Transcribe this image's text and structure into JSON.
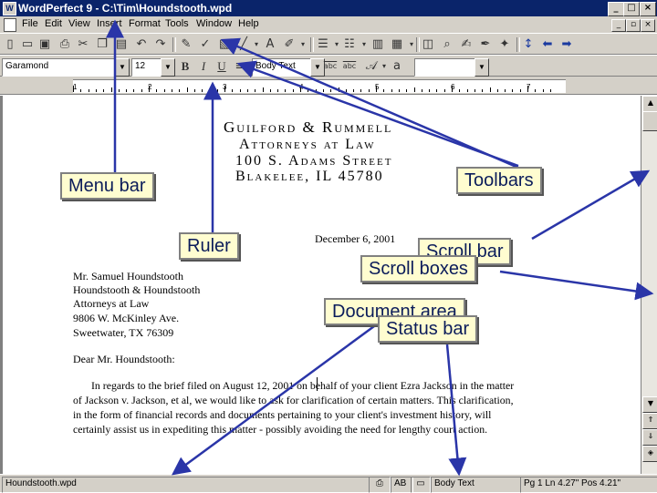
{
  "window": {
    "title": "WordPerfect 9 - C:\\Tim\\Houndstooth.wpd"
  },
  "menu": [
    "File",
    "Edit",
    "View",
    "Insert",
    "Format",
    "Tools",
    "Window",
    "Help"
  ],
  "property_bar": {
    "font": "Garamond",
    "size": "12",
    "style": "Body Text",
    "bold": "B",
    "italic": "I",
    "underline": "U",
    "abc1": "abc",
    "abc2": "abc"
  },
  "ruler": {
    "numbers": [
      "1",
      "2",
      "3",
      "4",
      "5",
      "6",
      "7"
    ]
  },
  "letter": {
    "letterhead": [
      "Guilford & Rummell",
      "Attorneys at Law",
      "100 S. Adams Street",
      "Blakelee, IL 45780"
    ],
    "date": "December 6, 2001",
    "recipient": [
      "Mr. Samuel Houndstooth",
      "Houndstooth & Houndstooth",
      "Attorneys at Law",
      "9806 W. McKinley Ave.",
      "Sweetwater, TX 76309"
    ],
    "salutation": "Dear Mr. Houndstooth:",
    "body": [
      "In regards to the brief filed on August 12, 2001 on behalf of your client Ezra Jackson in the matter",
      "of Jackson v. Jackson, et al, we would like to ask for clarification of certain matters. This clarification,",
      "in the form of financial records and documents pertaining to your client's investment history, will",
      "certainly assist us in expediting this matter - possibly avoiding the need for lengthy court action."
    ]
  },
  "status": {
    "filename": "Houndstooth.wpd",
    "mode": "AB",
    "style": "Body Text",
    "position": "Pg 1 Ln 4.27\" Pos 4.21\""
  },
  "callouts": {
    "menu_bar": "Menu bar",
    "toolbars": "Toolbars",
    "ruler": "Ruler",
    "scroll_bar": "Scroll bar",
    "scroll_boxes": "Scroll boxes",
    "document_area": "Document area",
    "status_bar": "Status bar"
  },
  "colors": {
    "title_bar": "#0a246a",
    "chrome": "#d4d0c8",
    "callout_text": "#0b1c5a",
    "arrow": "#2a35a8"
  }
}
